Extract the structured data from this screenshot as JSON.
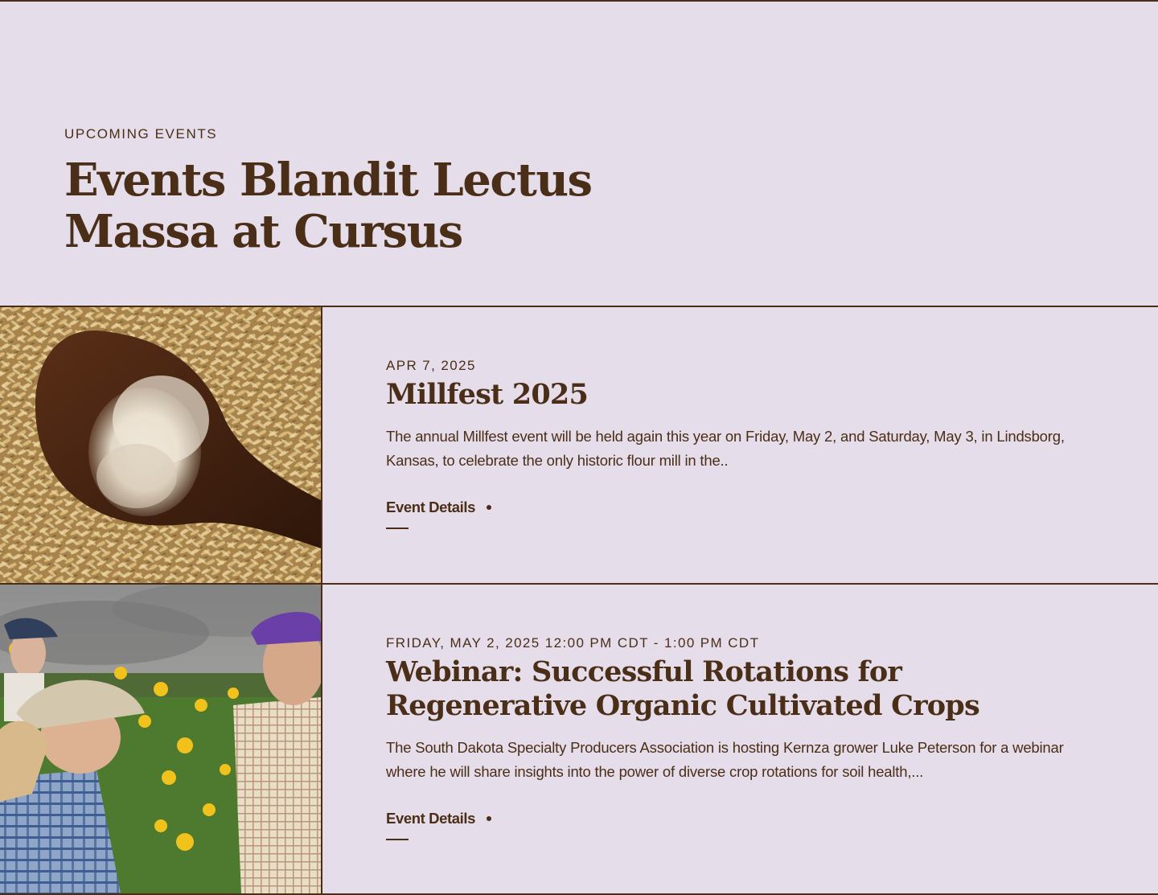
{
  "header": {
    "eyebrow": "UPCOMING EVENTS",
    "title": "Events Blandit Lectus Massa at Cursus"
  },
  "colors": {
    "background": "#e5dde9",
    "text": "#4a2e17"
  },
  "events": [
    {
      "image": "flour-on-wooden-spoon-over-grain",
      "date": "APR 7, 2025",
      "title": "Millfest 2025",
      "description": "The annual Millfest event will be held again this year on Friday, May 2, and Saturday, May 3, in Lindsborg, Kansas, to celebrate the only historic flour mill in the..",
      "link_label": "Event Details"
    },
    {
      "image": "people-inspecting-sunflowers-in-field",
      "date": "FRIDAY, MAY 2, 2025 12:00 PM CDT - 1:00 PM CDT",
      "title": "Webinar: Successful Rotations for Regenerative Organic Cultivated Crops",
      "description": "The South Dakota Specialty Producers Association is hosting Kernza grower Luke Peterson for a webinar where he will share insights into the power of diverse crop rotations for soil health,...",
      "link_label": "Event Details"
    }
  ]
}
